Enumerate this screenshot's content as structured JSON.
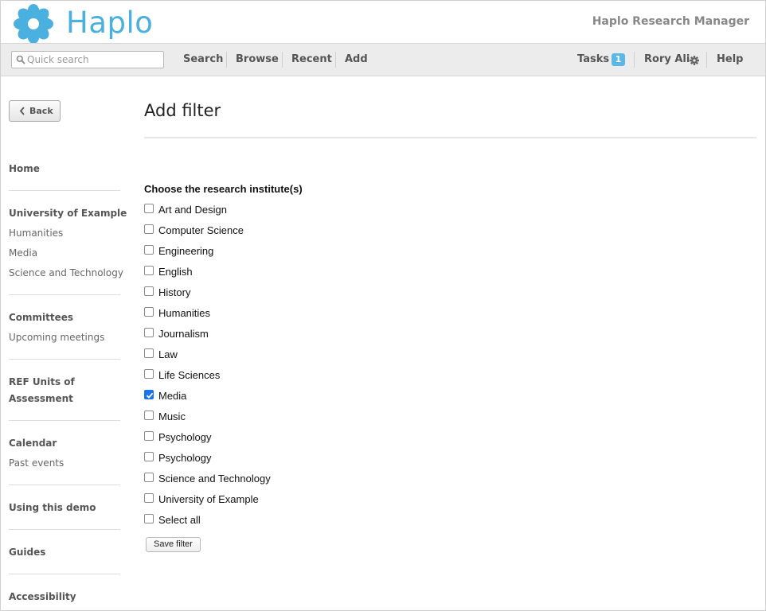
{
  "header": {
    "brand": "Haplo",
    "product": "Haplo Research Manager",
    "logo_color": "#4ab0df"
  },
  "toolbar": {
    "search_placeholder": "Quick search",
    "nav": [
      "Search",
      "Browse",
      "Recent",
      "Add"
    ],
    "tasks_label": "Tasks",
    "tasks_count": "1",
    "user": "Rory Ali",
    "help": "Help"
  },
  "sidebar": {
    "back_label": "Back",
    "home": "Home",
    "university": "University of Example",
    "university_items": [
      "Humanities",
      "Media",
      "Science and Technology"
    ],
    "committees": "Committees",
    "committees_items": [
      "Upcoming meetings"
    ],
    "ref_line1": "REF Units of",
    "ref_line2": "Assessment",
    "calendar": "Calendar",
    "calendar_items": [
      "Past events"
    ],
    "using_demo": "Using this demo",
    "guides": "Guides",
    "accessibility": "Accessibility"
  },
  "main": {
    "title": "Add filter",
    "question": "Choose the research institute(s)",
    "options": [
      {
        "label": "Art and Design",
        "checked": false
      },
      {
        "label": "Computer Science",
        "checked": false
      },
      {
        "label": "Engineering",
        "checked": false
      },
      {
        "label": "English",
        "checked": false
      },
      {
        "label": "History",
        "checked": false
      },
      {
        "label": "Humanities",
        "checked": false
      },
      {
        "label": "Journalism",
        "checked": false
      },
      {
        "label": "Law",
        "checked": false
      },
      {
        "label": "Life Sciences",
        "checked": false
      },
      {
        "label": "Media",
        "checked": true
      },
      {
        "label": "Music",
        "checked": false
      },
      {
        "label": "Psychology",
        "checked": false
      },
      {
        "label": "Psychology",
        "checked": false
      },
      {
        "label": "Science and Technology",
        "checked": false
      },
      {
        "label": "University of Example",
        "checked": false
      },
      {
        "label": "Select all",
        "checked": false
      }
    ],
    "save_label": "Save filter"
  },
  "colors": {
    "accent": "#4ab0df",
    "badge": "#5bb8e6",
    "checkbox_checked": "#1a73e8"
  }
}
